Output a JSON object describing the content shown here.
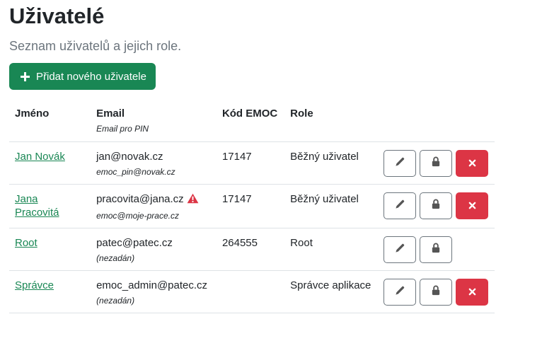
{
  "page": {
    "title": "Uživatelé",
    "subtitle": "Seznam uživatelů a jejich role.",
    "add_button_label": "Přidat nového uživatele"
  },
  "table": {
    "headers": {
      "name": "Jméno",
      "email": "Email",
      "email_sub": "Email pro PIN",
      "emoc_code": "Kód EMOC",
      "role": "Role"
    },
    "rows": [
      {
        "name": "Jan Novák",
        "email": "jan@novak.cz",
        "pin_email": "emoc_pin@novak.cz",
        "emoc_code": "17147",
        "role": "Běžný uživatel",
        "warning": false,
        "deletable": true
      },
      {
        "name": "Jana Pracovitá",
        "email": "pracovita@jana.cz",
        "pin_email": "emoc@moje-prace.cz",
        "emoc_code": "17147",
        "role": "Běžný uživatel",
        "warning": true,
        "deletable": true
      },
      {
        "name": "Root",
        "email": "patec@patec.cz",
        "pin_email": "(nezadán)",
        "emoc_code": "264555",
        "role": "Root",
        "warning": false,
        "deletable": false
      },
      {
        "name": "Správce",
        "email": "emoc_admin@patec.cz",
        "pin_email": "(nezadán)",
        "emoc_code": "",
        "role": "Správce aplikace",
        "warning": false,
        "deletable": true
      }
    ]
  },
  "icons": {
    "add": "plus-icon",
    "edit": "pencil-icon",
    "lock": "lock-icon",
    "delete": "x-icon",
    "warning": "warning-triangle-icon"
  },
  "colors": {
    "primary_green": "#198754",
    "danger_red": "#dc3545",
    "outline_gray": "#6c757d",
    "muted_text": "#6c757d"
  }
}
